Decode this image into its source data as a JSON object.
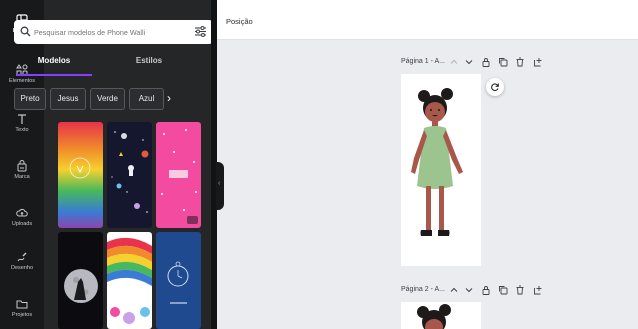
{
  "rail": [
    {
      "id": "design",
      "label": "Design",
      "icon": "layout-icon",
      "active": true
    },
    {
      "id": "elementos",
      "label": "Elementos",
      "icon": "shapes-icon",
      "active": false
    },
    {
      "id": "texto",
      "label": "Texto",
      "icon": "text-icon",
      "active": false
    },
    {
      "id": "marca",
      "label": "Marca",
      "icon": "brand-icon",
      "active": false
    },
    {
      "id": "uploads",
      "label": "Uploads",
      "icon": "upload-cloud-icon",
      "active": false
    },
    {
      "id": "desenho",
      "label": "Desenho",
      "icon": "draw-icon",
      "active": false
    },
    {
      "id": "projetos",
      "label": "Projetos",
      "icon": "folder-icon",
      "active": false
    }
  ],
  "panel": {
    "search_placeholder": "Pesquisar modelos de Phone Walli",
    "tabs": [
      "Modelos",
      "Estilos"
    ],
    "chips": [
      "Preto",
      "Jesus",
      "Verde",
      "Azul"
    ]
  },
  "topbar": {
    "position_label": "Posição"
  },
  "pages": [
    {
      "title": "Página 1 - A..."
    },
    {
      "title": "Página 2 - A..."
    }
  ],
  "colors": {
    "rail_bg": "#18191b",
    "panel_bg": "#252627",
    "accent": "#8b3dff",
    "canvas_bg": "#ebecf0",
    "dress": "#9cc48f",
    "skin": "#a8584a",
    "hair": "#1f1a1a"
  }
}
